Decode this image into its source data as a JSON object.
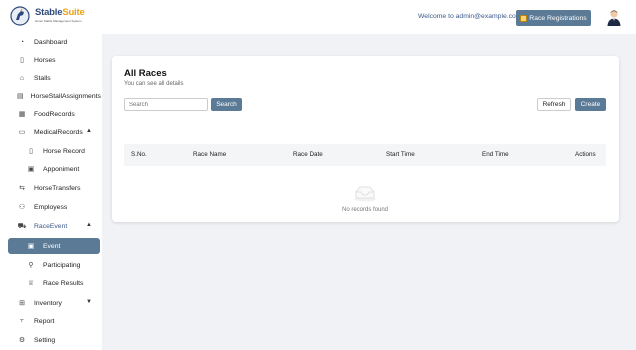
{
  "brand": {
    "name_part1": "Stable",
    "name_part2": "Suite",
    "tagline": "Horse Stable Management System"
  },
  "header": {
    "welcome": "Welcome to admin@example.com",
    "race_registrations_label": "Race Registrations"
  },
  "sidebar": {
    "items": [
      {
        "label": "Dashboard",
        "icon": "dashboard-icon"
      },
      {
        "label": "Horses",
        "icon": "horse-icon"
      },
      {
        "label": "Stalls",
        "icon": "home-icon"
      },
      {
        "label": "HorseStallAssignments",
        "icon": "assignment-icon"
      },
      {
        "label": "FoodRecords",
        "icon": "food-icon"
      },
      {
        "label": "MedicalRecords",
        "icon": "medical-icon"
      },
      {
        "label": "Horse Record",
        "icon": "document-icon"
      },
      {
        "label": "Apponiment",
        "icon": "calendar-icon"
      },
      {
        "label": "HorseTransfers",
        "icon": "transfer-icon"
      },
      {
        "label": "Employess",
        "icon": "users-icon"
      },
      {
        "label": "RaceEvent",
        "icon": "race-icon"
      },
      {
        "label": "Event",
        "icon": "calendar-icon"
      },
      {
        "label": "Participating",
        "icon": "person-icon"
      },
      {
        "label": "Race Results",
        "icon": "trophy-icon"
      },
      {
        "label": "Inventory",
        "icon": "grid-icon"
      },
      {
        "label": "Report",
        "icon": "chart-icon"
      },
      {
        "label": "Setting",
        "icon": "gear-icon"
      }
    ]
  },
  "main": {
    "title": "All Races",
    "subtitle": "You can see all details",
    "search_placeholder": "Search",
    "search_button": "Search",
    "refresh_button": "Refresh",
    "create_button": "Create",
    "columns": [
      "S.No.",
      "Race Name",
      "Race Date",
      "Start Time",
      "End Time",
      "Actions"
    ],
    "rows": [],
    "empty_text": "No records found"
  },
  "colors": {
    "primary": "#5b7a96",
    "brand_blue": "#2e4a7a",
    "brand_orange": "#e8a317",
    "background": "#f0f2f5"
  }
}
